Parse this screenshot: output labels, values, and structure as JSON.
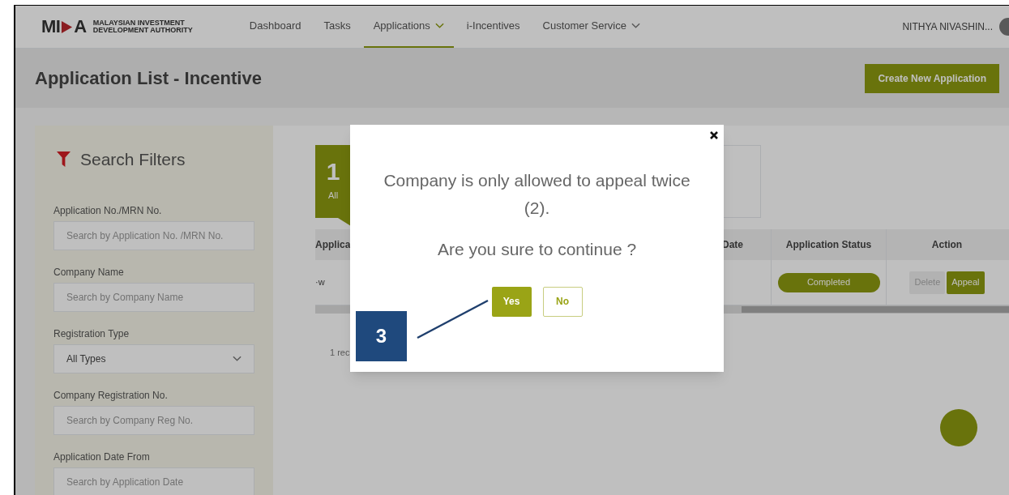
{
  "header": {
    "logo_letters": [
      "MI",
      "A"
    ],
    "logo_lines": [
      "MALAYSIAN INVESTMENT",
      "DEVELOPMENT AUTHORITY"
    ],
    "nav": [
      {
        "label": "Dashboard",
        "selected": false,
        "dropdown": false
      },
      {
        "label": "Tasks",
        "selected": false,
        "dropdown": false
      },
      {
        "label": "Applications",
        "selected": true,
        "dropdown": true
      },
      {
        "label": "i-Incentives",
        "selected": false,
        "dropdown": false
      },
      {
        "label": "Customer Service",
        "selected": false,
        "dropdown": true
      }
    ],
    "user_name": "NITHYA NIVASHIN..."
  },
  "page": {
    "title": "Application List - Incentive",
    "create_button": "Create New Application"
  },
  "filters": {
    "title": "Search Filters",
    "fields": [
      {
        "kind": "text",
        "label": "Application No./MRN No.",
        "placeholder": "Search by Application No. /MRN No."
      },
      {
        "kind": "text",
        "label": "Company Name",
        "placeholder": "Search by Company Name"
      },
      {
        "kind": "select",
        "label": "Registration Type",
        "value": "All Types"
      },
      {
        "kind": "text",
        "label": "Company Registration No.",
        "placeholder": "Search by Company Reg No."
      },
      {
        "kind": "text",
        "label": "Application Date From",
        "placeholder": "Search by Application Date"
      }
    ]
  },
  "status_tabs": [
    {
      "count": "1",
      "label": "All",
      "selected": true
    }
  ],
  "table": {
    "columns": [
      "Applica",
      "Date",
      "Application Status",
      "Action"
    ],
    "rows": [
      {
        "cells": [
          "·w",
          ""
        ],
        "status": "Completed",
        "actions": [
          {
            "label": "Delete",
            "disabled": true
          },
          {
            "label": "Appeal",
            "disabled": false
          }
        ]
      }
    ],
    "records": "1 rec"
  },
  "modal": {
    "message": "Company is only allowed to appeal twice (2).",
    "question": "Are you sure to continue ?",
    "buttons": [
      {
        "label": "Yes",
        "kind": "primary"
      },
      {
        "label": "No",
        "kind": "outline"
      }
    ]
  },
  "callout": {
    "number": "3"
  }
}
